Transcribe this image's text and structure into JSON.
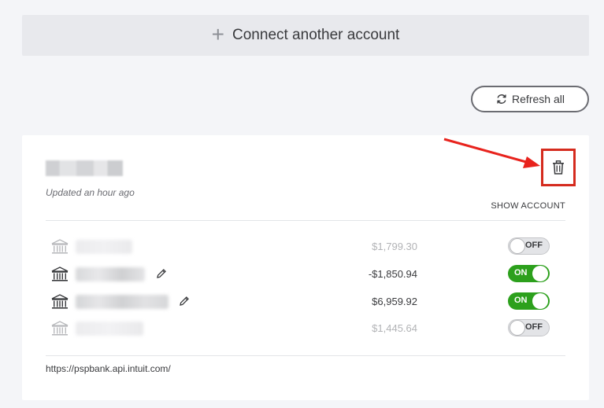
{
  "connect": {
    "plus": "+",
    "label": "Connect another account"
  },
  "refresh": {
    "label": "Refresh all",
    "icon": "refresh-icon"
  },
  "bank": {
    "updated": "Updated an hour ago",
    "show_account": "SHOW ACCOUNT",
    "delete_icon": "trash-icon",
    "url": "https://pspbank.api.intuit.com/"
  },
  "accounts": [
    {
      "amount": "$1,799.30",
      "toggle": "OFF",
      "state": "off"
    },
    {
      "amount": "-$1,850.94",
      "toggle": "ON",
      "state": "on"
    },
    {
      "amount": "$6,959.92",
      "toggle": "ON",
      "state": "on"
    },
    {
      "amount": "$1,445.64",
      "toggle": "OFF",
      "state": "off"
    }
  ],
  "colors": {
    "on": "#2ca01c",
    "highlight": "#d52b1e",
    "background": "#f4f5f8"
  }
}
